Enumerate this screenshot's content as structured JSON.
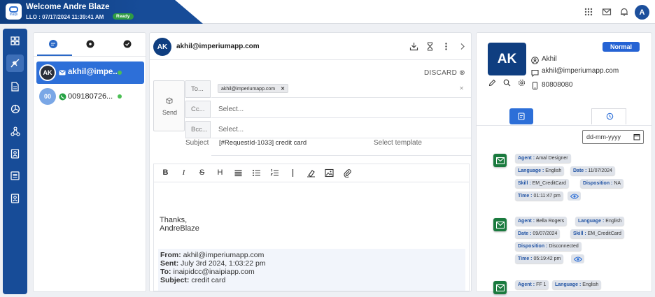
{
  "header": {
    "welcome": "Welcome Andre Blaze",
    "llo": "LLO : 07/17/2024   11:39:41 AM",
    "status": "Ready",
    "avatar_initial": "A",
    "logo_text": "inaipi"
  },
  "sidebar": {
    "items": [
      "grid-icon",
      "agent-icon",
      "document-icon",
      "dashboard-icon",
      "integration-icon",
      "contacts-icon",
      "list-icon",
      "profile-icon"
    ]
  },
  "conversations": {
    "items": [
      {
        "initials": "AK",
        "name": "akhil@impe...",
        "channel": "email",
        "online": true
      },
      {
        "initials": "00",
        "name": "009180726...",
        "channel": "whatsapp",
        "online": true
      }
    ]
  },
  "compose": {
    "header_initials": "AK",
    "header_title": "akhil@imperiumapp.com",
    "discard": "DISCARD",
    "send": "Send",
    "to_label": "To...",
    "to_chip": "akhil@imperiumapp.com",
    "cc_label": "Cc...",
    "cc_placeholder": "Select...",
    "bcc_label": "Bcc...",
    "bcc_placeholder": "Select...",
    "subject_label": "Subject",
    "subject_value": "[#RequestId-1033] credit card",
    "template_placeholder": "Select template",
    "toolbar": [
      "B",
      "I",
      "S",
      "H"
    ],
    "body": {
      "line1": "Thanks,",
      "line2": "AndreBlaze",
      "from_label": "From:",
      "from_value": " akhil@imperiumapp.com",
      "sent_label": "Sent:",
      "sent_value": " July 3rd 2024, 1:03:22 pm",
      "to_label": "To:",
      "to_value": " inaipidcc@inaipiapp.com",
      "subject_label": "Subject:",
      "subject_value": " credit card"
    }
  },
  "contact": {
    "initials": "AK",
    "priority": "Normal",
    "name": "Akhil",
    "email": "akhil@imperiumapp.com",
    "phone": "80808080",
    "date_placeholder": "dd-mm-yyyy",
    "history": [
      {
        "agent": "Amal Designer",
        "language": "English",
        "date": "11/07/2024",
        "skill": "EM_CreditCard",
        "disposition": "NA",
        "time": "01:11:47 pm"
      },
      {
        "agent": "Bella Rogers",
        "language": "English",
        "date": "09/07/2024",
        "skill": "EM_CreditCard",
        "disposition": "Disconnected",
        "time": "05:19:42 pm"
      },
      {
        "agent": "FF 1",
        "language": "English"
      }
    ],
    "labels": {
      "agent": "Agent :",
      "language": "Language :",
      "date": "Date :",
      "skill": "Skill :",
      "disposition": "Disposition :",
      "time": "Time :"
    }
  }
}
